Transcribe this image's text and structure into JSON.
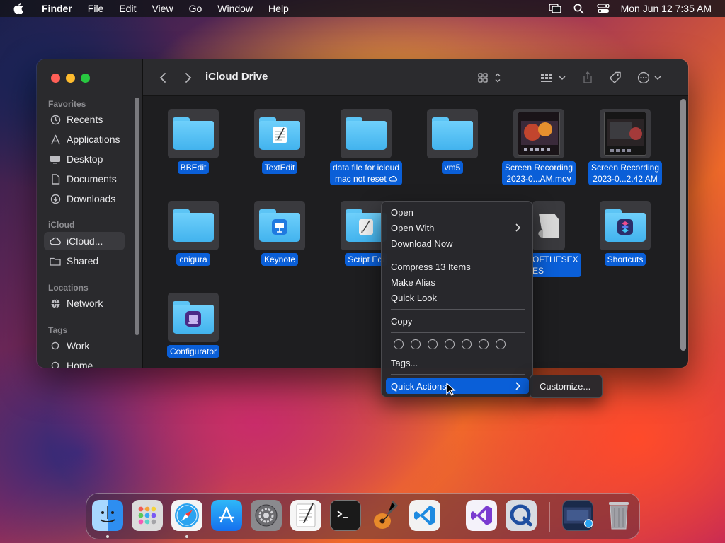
{
  "menubar": {
    "app_name": "Finder",
    "menus": [
      "File",
      "Edit",
      "View",
      "Go",
      "Window",
      "Help"
    ],
    "clock": "Mon Jun 12  7:35 AM"
  },
  "window": {
    "title": "iCloud Drive"
  },
  "sidebar": {
    "favorites_header": "Favorites",
    "favorites": [
      {
        "label": "Recents",
        "icon": "clock-icon"
      },
      {
        "label": "Applications",
        "icon": "applications-icon"
      },
      {
        "label": "Desktop",
        "icon": "desktop-icon"
      },
      {
        "label": "Documents",
        "icon": "document-icon"
      },
      {
        "label": "Downloads",
        "icon": "download-icon"
      }
    ],
    "icloud_header": "iCloud",
    "icloud": [
      {
        "label": "iCloud...",
        "icon": "cloud-icon",
        "selected": true
      },
      {
        "label": "Shared",
        "icon": "shared-folder-icon"
      }
    ],
    "locations_header": "Locations",
    "locations": [
      {
        "label": "Network",
        "icon": "globe-icon"
      }
    ],
    "tags_header": "Tags",
    "tags": [
      {
        "label": "Work"
      },
      {
        "label": "Home"
      }
    ]
  },
  "files": [
    {
      "label": "BBEdit",
      "kind": "folder"
    },
    {
      "label": "TextEdit",
      "kind": "folder"
    },
    {
      "label": "data file for icloud",
      "label2": "mac not reset",
      "kind": "folder"
    },
    {
      "label": "vm5",
      "kind": "folder"
    },
    {
      "label": "Screen Recording",
      "label2": "2023-0...AM.mov",
      "kind": "video"
    },
    {
      "label": "Screen Recording",
      "label2": "2023-0...2.42 AM",
      "kind": "video"
    },
    {
      "label": "cnigura",
      "kind": "folder"
    },
    {
      "label": "Keynote",
      "kind": "folder"
    },
    {
      "label": "Script Edi",
      "kind": "folder"
    },
    {
      "label": "OFTHESEX",
      "label2": "ES",
      "kind": "file"
    },
    {
      "label": "Shortcuts",
      "kind": "folder"
    },
    {
      "label": "Configurator",
      "kind": "folder"
    }
  ],
  "context_menu": {
    "open": "Open",
    "open_with": "Open With",
    "download_now": "Download Now",
    "compress": "Compress 13 Items",
    "make_alias": "Make Alias",
    "quick_look": "Quick Look",
    "copy": "Copy",
    "tags": "Tags...",
    "quick_actions": "Quick Actions"
  },
  "submenu": {
    "customize": "Customize..."
  },
  "colors": {
    "selection": "#0a5fd8",
    "folder": "#5cc4f5"
  }
}
